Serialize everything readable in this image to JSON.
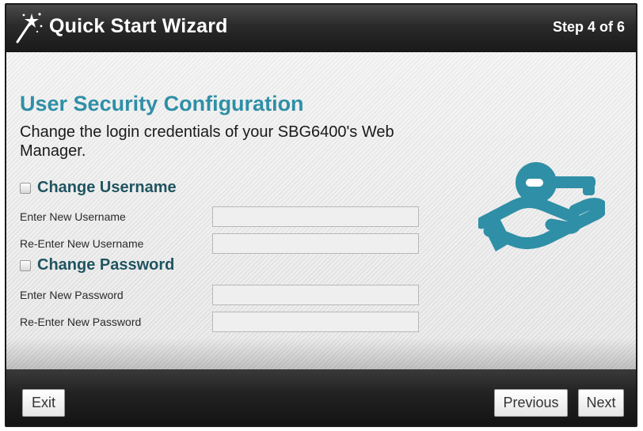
{
  "header": {
    "title": "Quick Start Wizard",
    "step": "Step 4 of 6",
    "icon": "magic-wand-icon"
  },
  "main": {
    "title": "User Security Configuration",
    "description": "Change the login credentials of your SBG6400's Web Manager.",
    "icon": "key-in-hand-icon",
    "accent_color": "#2f8fa6",
    "username_section": {
      "checkbox_label": "Change Username",
      "checked": false,
      "new_label": "Enter New Username",
      "new_value": "",
      "confirm_label": "Re-Enter New Username",
      "confirm_value": ""
    },
    "password_section": {
      "checkbox_label": "Change Password",
      "checked": false,
      "new_label": "Enter New Password",
      "new_value": "",
      "confirm_label": "Re-Enter New Password",
      "confirm_value": ""
    }
  },
  "footer": {
    "exit_label": "Exit",
    "previous_label": "Previous",
    "next_label": "Next"
  }
}
